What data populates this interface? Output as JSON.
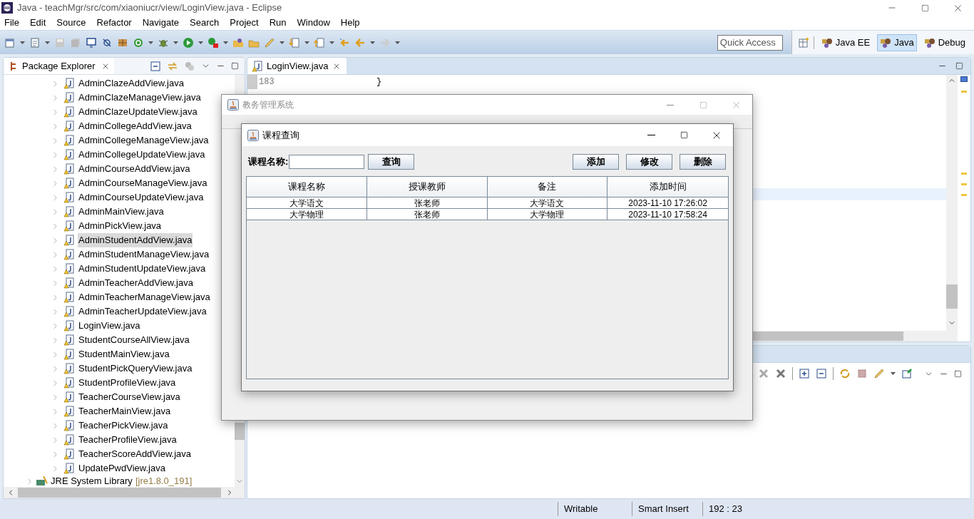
{
  "window": {
    "title": "Java - teachMgr/src/com/xiaoniucr/view/LoginView.java - Eclipse"
  },
  "menu": [
    "File",
    "Edit",
    "Source",
    "Refactor",
    "Navigate",
    "Search",
    "Project",
    "Run",
    "Window",
    "Help"
  ],
  "quick_access": {
    "placeholder": "Quick Access"
  },
  "perspectives": [
    {
      "label": "Java EE",
      "selected": false
    },
    {
      "label": "Java",
      "selected": true
    },
    {
      "label": "Debug",
      "selected": false
    }
  ],
  "package_explorer": {
    "title": "Package Explorer",
    "items": [
      {
        "label": "AdminClazeAddView.java",
        "selected": false
      },
      {
        "label": "AdminClazeManageView.java",
        "selected": false
      },
      {
        "label": "AdminClazeUpdateView.java",
        "selected": false
      },
      {
        "label": "AdminCollegeAddView.java",
        "selected": false
      },
      {
        "label": "AdminCollegeManageView.java",
        "selected": false
      },
      {
        "label": "AdminCollegeUpdateView.java",
        "selected": false
      },
      {
        "label": "AdminCourseAddView.java",
        "selected": false
      },
      {
        "label": "AdminCourseManageView.java",
        "selected": false
      },
      {
        "label": "AdminCourseUpdateView.java",
        "selected": false
      },
      {
        "label": "AdminMainView.java",
        "selected": false
      },
      {
        "label": "AdminPickView.java",
        "selected": false
      },
      {
        "label": "AdminStudentAddView.java",
        "selected": true
      },
      {
        "label": "AdminStudentManageView.java",
        "selected": false
      },
      {
        "label": "AdminStudentUpdateView.java",
        "selected": false
      },
      {
        "label": "AdminTeacherAddView.java",
        "selected": false
      },
      {
        "label": "AdminTeacherManageView.java",
        "selected": false
      },
      {
        "label": "AdminTeacherUpdateView.java",
        "selected": false
      },
      {
        "label": "LoginView.java",
        "selected": false
      },
      {
        "label": "StudentCourseAllView.java",
        "selected": false
      },
      {
        "label": "StudentMainView.java",
        "selected": false
      },
      {
        "label": "StudentPickQueryView.java",
        "selected": false
      },
      {
        "label": "StudentProfileView.java",
        "selected": false
      },
      {
        "label": "TeacherCourseView.java",
        "selected": false
      },
      {
        "label": "TeacherMainView.java",
        "selected": false
      },
      {
        "label": "TeacherPickView.java",
        "selected": false
      },
      {
        "label": "TeacherProfileView.java",
        "selected": false
      },
      {
        "label": "TeacherScoreAddView.java",
        "selected": false
      },
      {
        "label": "UpdatePwdView.java",
        "selected": false
      }
    ],
    "library": {
      "label": "JRE System Library",
      "detail": "[jre1.8.0_191]"
    }
  },
  "editor": {
    "tab": "LoginView.java",
    "line_number": "183",
    "code": "}"
  },
  "status_bar": [
    "Writable",
    "Smart Insert",
    "192 : 23"
  ],
  "app_window": {
    "title": "教务管理系统"
  },
  "dialog": {
    "title": "课程查询",
    "search_label": "课程名称:",
    "search_button": "查询",
    "buttons": [
      "添加",
      "修改",
      "删除"
    ],
    "table": {
      "columns": [
        "课程名称",
        "授课教师",
        "备注",
        "添加时间"
      ],
      "rows": [
        [
          "大学语文",
          "张老师",
          "大学语文",
          "2023-11-10 17:26:02"
        ],
        [
          "大学物理",
          "张老师",
          "大学物理",
          "2023-11-10 17:58:24"
        ]
      ]
    }
  }
}
